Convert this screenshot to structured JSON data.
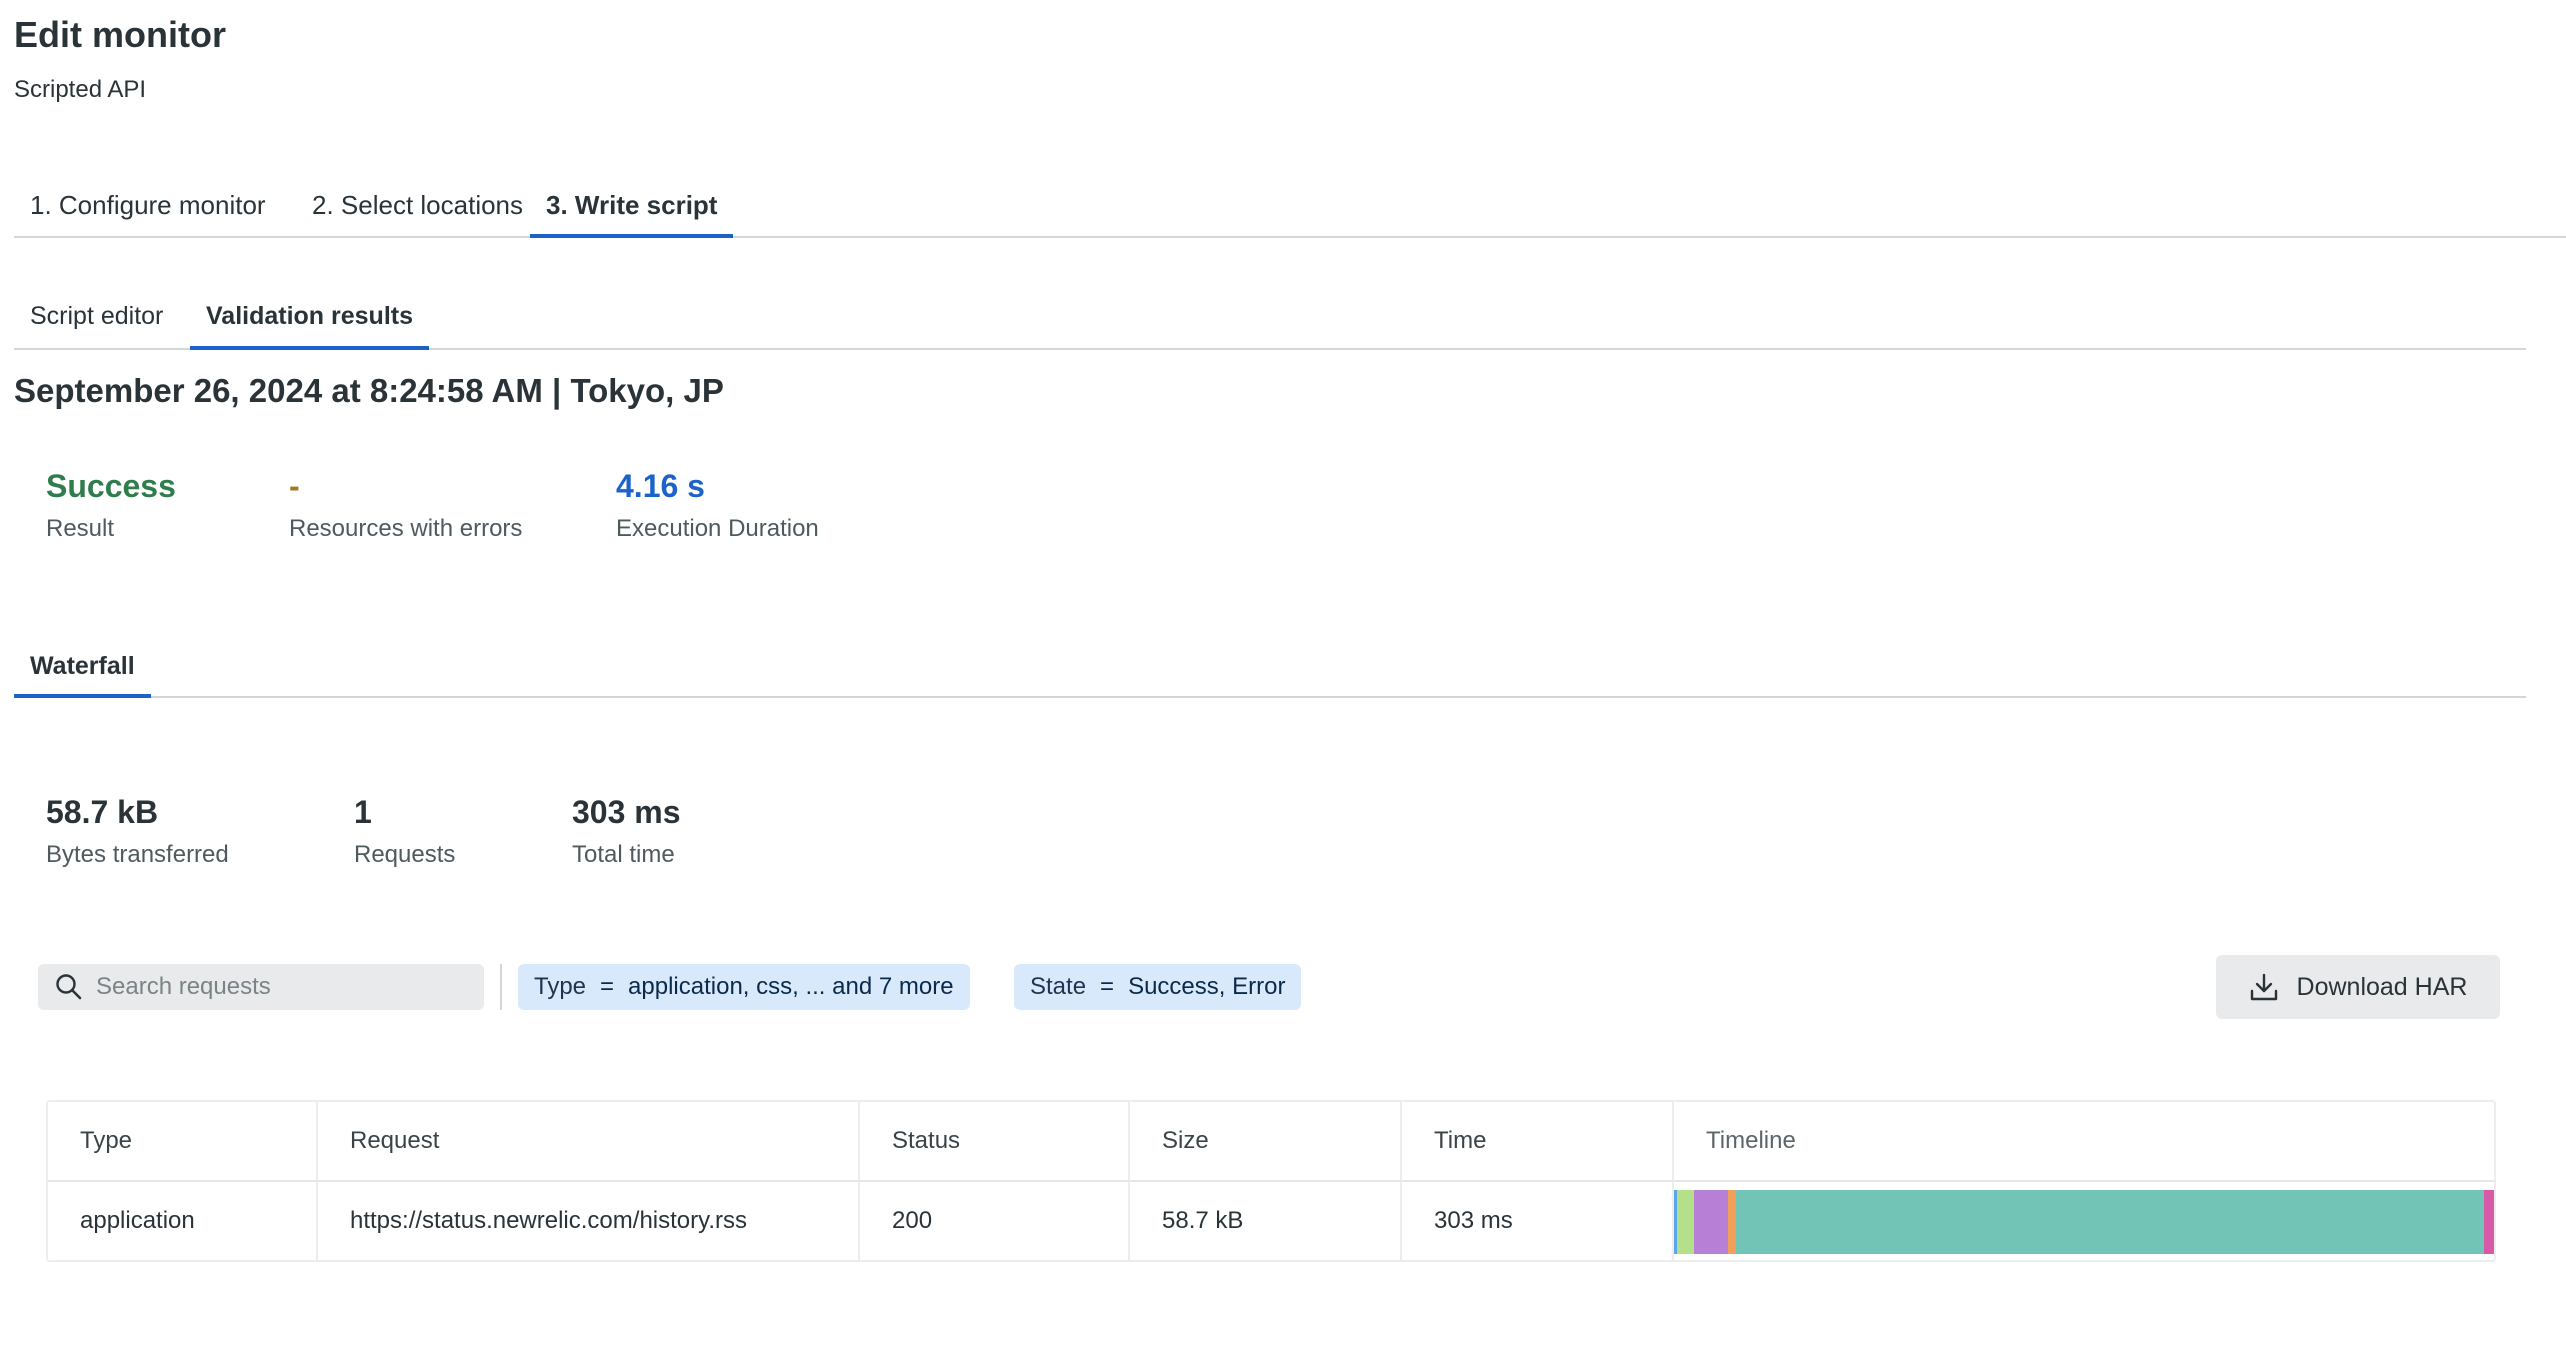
{
  "page": {
    "title": "Edit monitor",
    "subtitle": "Scripted API"
  },
  "steps": [
    {
      "label": "1. Configure monitor",
      "active": false
    },
    {
      "label": "2. Select locations",
      "active": false
    },
    {
      "label": "3. Write script",
      "active": true
    }
  ],
  "subtabs": [
    {
      "label": "Script editor",
      "active": false
    },
    {
      "label": "Validation results",
      "active": true
    }
  ],
  "run": {
    "header": "September 26, 2024 at 8:24:58 AM | Tokyo, JP"
  },
  "summary": {
    "result": {
      "value": "Success",
      "label": "Result",
      "color": "#2f7d4c"
    },
    "errors": {
      "value": "-",
      "label": "Resources with errors",
      "color": "#a07a1e"
    },
    "duration": {
      "value": "4.16 s",
      "label": "Execution Duration",
      "color": "#1c63c9"
    }
  },
  "waterfall_tab": {
    "label": "Waterfall"
  },
  "waterfall_stats": {
    "bytes": {
      "value": "58.7 kB",
      "label": "Bytes transferred"
    },
    "requests": {
      "value": "1",
      "label": "Requests"
    },
    "time": {
      "value": "303 ms",
      "label": "Total time"
    }
  },
  "filters": {
    "search_placeholder": "Search requests",
    "type_chip": {
      "key": "Type",
      "op": "=",
      "value": "application, css, ... and 7 more"
    },
    "state_chip": {
      "key": "State",
      "op": "=",
      "value": "Success, Error"
    },
    "download_label": "Download HAR"
  },
  "table": {
    "columns": [
      "Type",
      "Request",
      "Status",
      "Size",
      "Time",
      "Timeline"
    ],
    "rows": [
      {
        "type": "application",
        "request": "https://status.newrelic.com/history.rss",
        "status": "200",
        "size": "58.7 kB",
        "time": "303 ms",
        "timeline_segments": [
          {
            "phase": "blocked",
            "fraction": 0.004,
            "color": "#5aa6e6"
          },
          {
            "phase": "dns",
            "fraction": 0.02,
            "color": "#b5e08a"
          },
          {
            "phase": "connect",
            "fraction": 0.042,
            "color": "#b77fd6"
          },
          {
            "phase": "ssl",
            "fraction": 0.01,
            "color": "#f0a05a"
          },
          {
            "phase": "wait",
            "fraction": 0.912,
            "color": "#72c5b6"
          },
          {
            "phase": "receive",
            "fraction": 0.012,
            "color": "#d65aa8"
          }
        ]
      }
    ]
  }
}
